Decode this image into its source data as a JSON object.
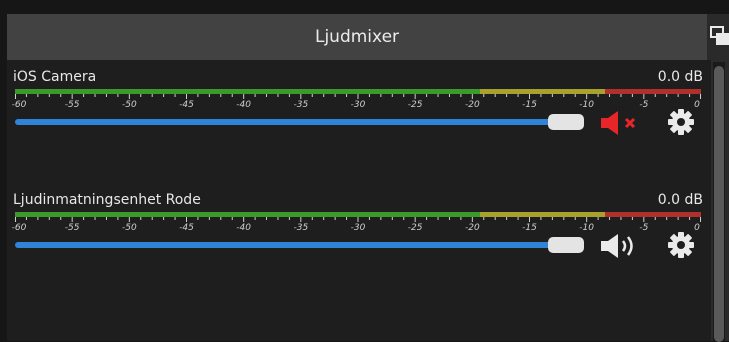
{
  "dock": {
    "title": "Ljudmixer"
  },
  "meter_scale": [
    "-60",
    "-55",
    "-50",
    "-45",
    "-40",
    "-35",
    "-30",
    "-25",
    "-20",
    "-15",
    "-10",
    "-5",
    "0"
  ],
  "channels": [
    {
      "name": "iOS Camera",
      "level": "0.0 dB",
      "volume_fraction": 1.0,
      "muted": true
    },
    {
      "name": "Ljudinmatningsenhet Rode",
      "level": "0.0 dB",
      "volume_fraction": 1.0,
      "muted": false
    }
  ],
  "colors": {
    "meter_green": "#3b9b2a",
    "meter_yellow": "#a8a22c",
    "meter_red": "#b2302c",
    "slider_fill": "#2f84d8",
    "muted_icon": "#e8262a"
  },
  "icons": {
    "float": "dock-float-icon",
    "mute": "speaker-muted-icon",
    "unmute": "speaker-on-icon",
    "settings": "gear-icon"
  }
}
